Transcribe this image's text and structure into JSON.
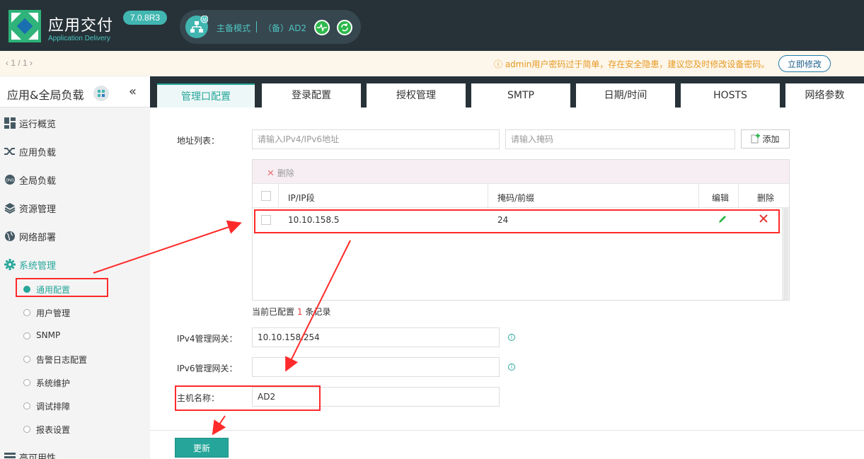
{
  "header": {
    "brand_cn": "应用交付",
    "brand_en": "Application Delivery",
    "version": "7.0.8R3",
    "ha_mode": "主备模式",
    "ha_device": "（备）AD2"
  },
  "notice": {
    "pager": "‹ 1 / 1 ›",
    "message": "ⓘ  admin用户密码过于简单，存在安全隐患，建议您及时修改设备密码。",
    "button_label": "立即修改"
  },
  "sidebar": {
    "title": "应用&全局负载",
    "collapse_glyph": "«",
    "items": [
      {
        "label": "运行概览",
        "icon": "dashboard-icon"
      },
      {
        "label": "应用负载",
        "icon": "shuffle-icon"
      },
      {
        "label": "全局负载",
        "icon": "globe-dns-icon"
      },
      {
        "label": "资源管理",
        "icon": "layers-icon"
      },
      {
        "label": "网络部署",
        "icon": "globe-icon"
      },
      {
        "label": "系统管理",
        "icon": "gear-icon"
      },
      {
        "label": "高可用性",
        "icon": "list-icon"
      }
    ],
    "sub_items": [
      {
        "label": "通用配置"
      },
      {
        "label": "用户管理"
      },
      {
        "label": "SNMP"
      },
      {
        "label": "告警日志配置"
      },
      {
        "label": "系统维护"
      },
      {
        "label": "调试排障"
      },
      {
        "label": "报表设置"
      }
    ]
  },
  "tabs": [
    {
      "label": "管理口配置"
    },
    {
      "label": "登录配置"
    },
    {
      "label": "授权管理"
    },
    {
      "label": "SMTP"
    },
    {
      "label": "日期/时间"
    },
    {
      "label": "HOSTS"
    },
    {
      "label": "网络参数"
    }
  ],
  "form": {
    "address_list_label": "地址列表：",
    "ip_placeholder": "请输入IPv4/IPv6地址",
    "mask_placeholder": "请输入掩码",
    "add_label": "添加",
    "delete_label": "删除",
    "table_headers": [
      "IP/IP段",
      "掩码/前缀",
      "编辑",
      "删除"
    ],
    "rows": [
      {
        "ip": "10.10.158.5",
        "mask": "24"
      }
    ],
    "record_count_prefix": "当前已配置",
    "record_count": "1",
    "record_count_suffix": "条记录",
    "ipv4_gateway_label": "IPv4管理网关：",
    "ipv4_gateway_value": "10.10.158.254",
    "ipv6_gateway_label": "IPv6管理网关：",
    "ipv6_gateway_value": "",
    "hostname_label": "主机名称：",
    "hostname_value": "AD2",
    "info_glyph": "i",
    "update_label": "更新"
  },
  "colors": {
    "accent": "#26a69a",
    "header_bg": "#263238",
    "annotation_red": "#ff2a2a",
    "status_green": "#2db84b"
  }
}
